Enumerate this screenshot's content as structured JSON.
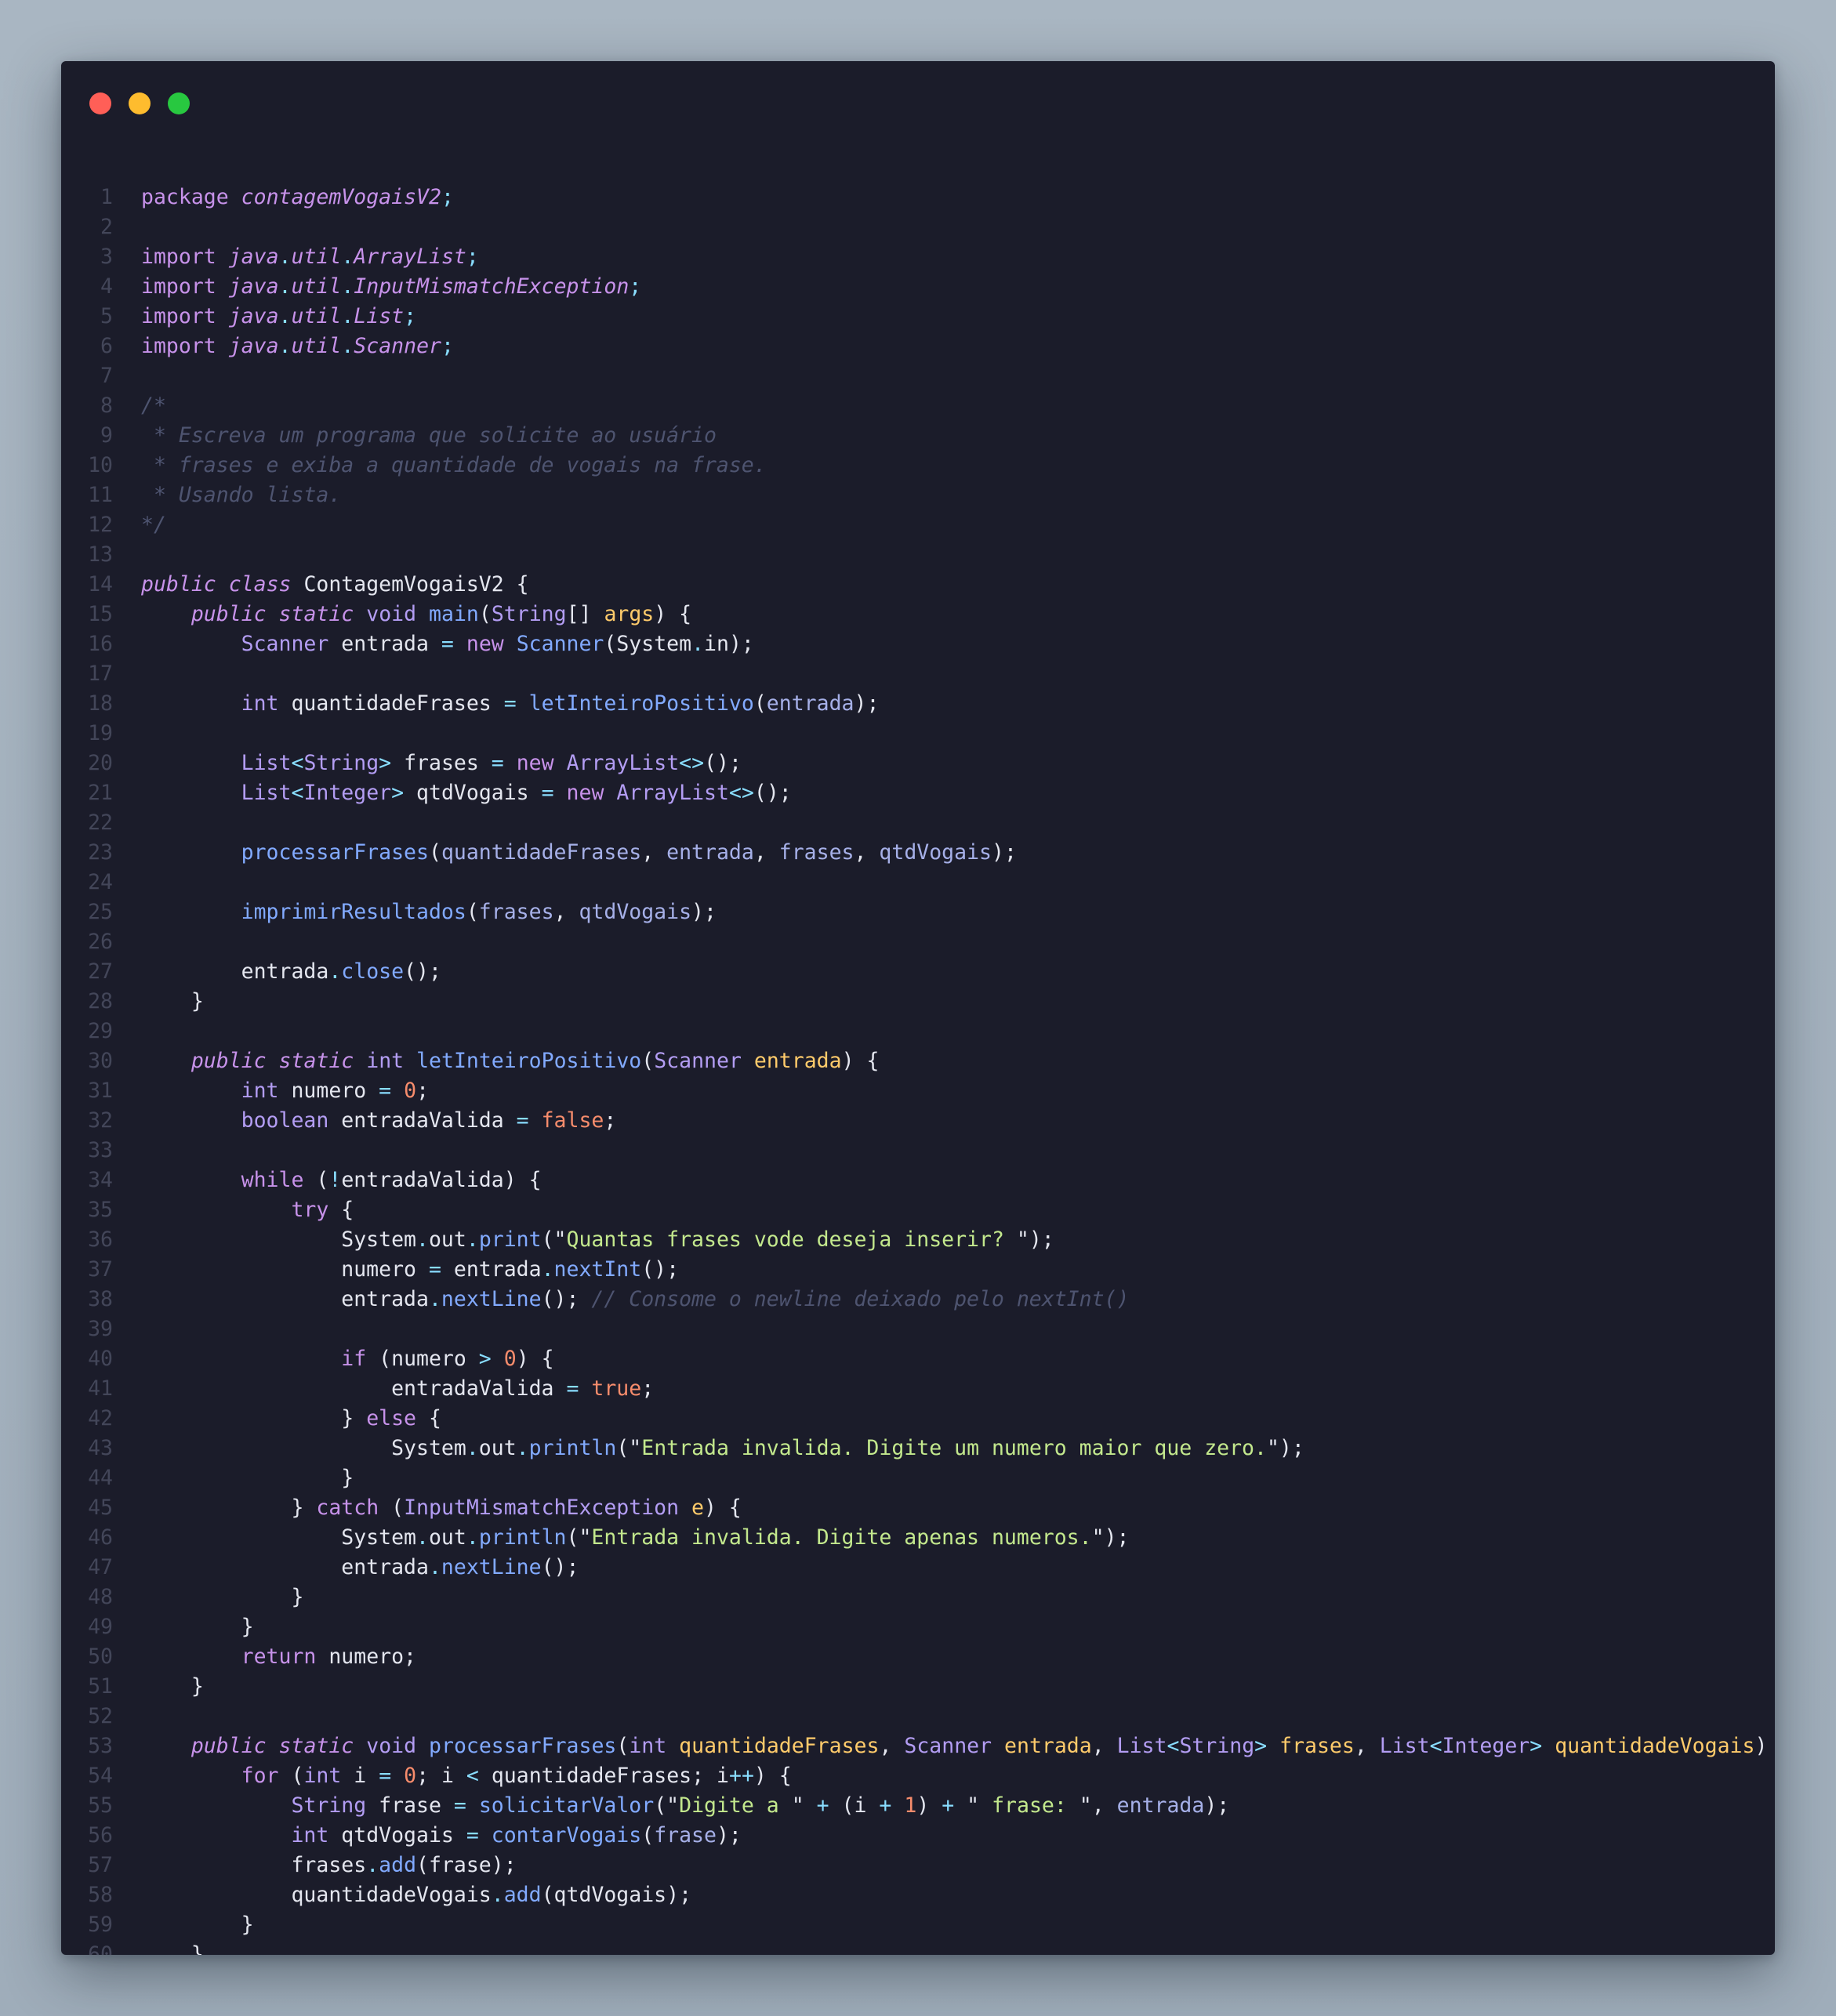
{
  "window": {
    "controls": [
      "close",
      "minimize",
      "maximize"
    ]
  },
  "colors": {
    "background": "#a9b6c2",
    "editor": "#1b1c2a",
    "keyword": "#c792ea",
    "function": "#82aaff",
    "string": "#c3e88d",
    "number": "#f78c6c",
    "param": "#ffcb6b",
    "comment": "#4e5470"
  },
  "code": {
    "language": "java",
    "lines": [
      [
        [
          "kw",
          "package"
        ],
        [
          "txt",
          " "
        ],
        [
          "pkg",
          "contagemVogaisV2"
        ],
        [
          "punc",
          ";"
        ]
      ],
      [],
      [
        [
          "kw",
          "import"
        ],
        [
          "txt",
          " "
        ],
        [
          "pkg",
          "java"
        ],
        [
          "punc",
          "."
        ],
        [
          "pkg",
          "util"
        ],
        [
          "punc",
          "."
        ],
        [
          "pkg",
          "ArrayList"
        ],
        [
          "punc",
          ";"
        ]
      ],
      [
        [
          "kw",
          "import"
        ],
        [
          "txt",
          " "
        ],
        [
          "pkg",
          "java"
        ],
        [
          "punc",
          "."
        ],
        [
          "pkg",
          "util"
        ],
        [
          "punc",
          "."
        ],
        [
          "pkg",
          "InputMismatchException"
        ],
        [
          "punc",
          ";"
        ]
      ],
      [
        [
          "kw",
          "import"
        ],
        [
          "txt",
          " "
        ],
        [
          "pkg",
          "java"
        ],
        [
          "punc",
          "."
        ],
        [
          "pkg",
          "util"
        ],
        [
          "punc",
          "."
        ],
        [
          "pkg",
          "List"
        ],
        [
          "punc",
          ";"
        ]
      ],
      [
        [
          "kw",
          "import"
        ],
        [
          "txt",
          " "
        ],
        [
          "pkg",
          "java"
        ],
        [
          "punc",
          "."
        ],
        [
          "pkg",
          "util"
        ],
        [
          "punc",
          "."
        ],
        [
          "pkg",
          "Scanner"
        ],
        [
          "punc",
          ";"
        ]
      ],
      [],
      [
        [
          "cmt",
          "/*"
        ]
      ],
      [
        [
          "cmt",
          " * Escreva um programa que solicite ao usuário"
        ]
      ],
      [
        [
          "cmt",
          " * frases e exiba a quantidade de vogais na frase."
        ]
      ],
      [
        [
          "cmt",
          " * Usando lista."
        ]
      ],
      [
        [
          "cmt",
          "*/"
        ]
      ],
      [],
      [
        [
          "kwi",
          "public"
        ],
        [
          "txt",
          " "
        ],
        [
          "kwi",
          "class"
        ],
        [
          "txt",
          " ContagemVogaisV2 {"
        ]
      ],
      [
        [
          "txt",
          "    "
        ],
        [
          "kwi",
          "public"
        ],
        [
          "txt",
          " "
        ],
        [
          "kwi",
          "static"
        ],
        [
          "txt",
          " "
        ],
        [
          "typ",
          "void"
        ],
        [
          "txt",
          " "
        ],
        [
          "fn",
          "main"
        ],
        [
          "txt",
          "("
        ],
        [
          "typ",
          "String"
        ],
        [
          "txt",
          "[] "
        ],
        [
          "par",
          "args"
        ],
        [
          "txt",
          ") {"
        ]
      ],
      [
        [
          "txt",
          "        "
        ],
        [
          "typ",
          "Scanner"
        ],
        [
          "txt",
          " entrada "
        ],
        [
          "punc",
          "="
        ],
        [
          "txt",
          " "
        ],
        [
          "kw",
          "new"
        ],
        [
          "txt",
          " "
        ],
        [
          "fn",
          "Scanner"
        ],
        [
          "txt",
          "(System"
        ],
        [
          "punc",
          "."
        ],
        [
          "txt",
          "in);"
        ]
      ],
      [],
      [
        [
          "txt",
          "        "
        ],
        [
          "typ",
          "int"
        ],
        [
          "txt",
          " quantidadeFrases "
        ],
        [
          "punc",
          "="
        ],
        [
          "txt",
          " "
        ],
        [
          "fn",
          "letInteiroPositivo"
        ],
        [
          "txt",
          "("
        ],
        [
          "arg",
          "entrada"
        ],
        [
          "txt",
          ");"
        ]
      ],
      [],
      [
        [
          "txt",
          "        "
        ],
        [
          "typ",
          "List"
        ],
        [
          "punc",
          "<"
        ],
        [
          "typ",
          "String"
        ],
        [
          "punc",
          ">"
        ],
        [
          "txt",
          " frases "
        ],
        [
          "punc",
          "="
        ],
        [
          "txt",
          " "
        ],
        [
          "kw",
          "new"
        ],
        [
          "txt",
          " "
        ],
        [
          "typ",
          "ArrayList"
        ],
        [
          "punc",
          "<>"
        ],
        [
          "txt",
          "();"
        ]
      ],
      [
        [
          "txt",
          "        "
        ],
        [
          "typ",
          "List"
        ],
        [
          "punc",
          "<"
        ],
        [
          "typ",
          "Integer"
        ],
        [
          "punc",
          ">"
        ],
        [
          "txt",
          " qtdVogais "
        ],
        [
          "punc",
          "="
        ],
        [
          "txt",
          " "
        ],
        [
          "kw",
          "new"
        ],
        [
          "txt",
          " "
        ],
        [
          "typ",
          "ArrayList"
        ],
        [
          "punc",
          "<>"
        ],
        [
          "txt",
          "();"
        ]
      ],
      [],
      [
        [
          "txt",
          "        "
        ],
        [
          "fn",
          "processarFrases"
        ],
        [
          "txt",
          "("
        ],
        [
          "arg",
          "quantidadeFrases"
        ],
        [
          "txt",
          ", "
        ],
        [
          "arg",
          "entrada"
        ],
        [
          "txt",
          ", "
        ],
        [
          "arg",
          "frases"
        ],
        [
          "txt",
          ", "
        ],
        [
          "arg",
          "qtdVogais"
        ],
        [
          "txt",
          ");"
        ]
      ],
      [],
      [
        [
          "txt",
          "        "
        ],
        [
          "fn",
          "imprimirResultados"
        ],
        [
          "txt",
          "("
        ],
        [
          "arg",
          "frases"
        ],
        [
          "txt",
          ", "
        ],
        [
          "arg",
          "qtdVogais"
        ],
        [
          "txt",
          ");"
        ]
      ],
      [],
      [
        [
          "txt",
          "        entrada"
        ],
        [
          "punc",
          "."
        ],
        [
          "fn",
          "close"
        ],
        [
          "txt",
          "();"
        ]
      ],
      [
        [
          "txt",
          "    }"
        ]
      ],
      [],
      [
        [
          "txt",
          "    "
        ],
        [
          "kwi",
          "public"
        ],
        [
          "txt",
          " "
        ],
        [
          "kwi",
          "static"
        ],
        [
          "txt",
          " "
        ],
        [
          "typ",
          "int"
        ],
        [
          "txt",
          " "
        ],
        [
          "fn",
          "letInteiroPositivo"
        ],
        [
          "txt",
          "("
        ],
        [
          "typ",
          "Scanner"
        ],
        [
          "txt",
          " "
        ],
        [
          "par",
          "entrada"
        ],
        [
          "txt",
          ") {"
        ]
      ],
      [
        [
          "txt",
          "        "
        ],
        [
          "typ",
          "int"
        ],
        [
          "txt",
          " numero "
        ],
        [
          "punc",
          "="
        ],
        [
          "txt",
          " "
        ],
        [
          "num",
          "0"
        ],
        [
          "txt",
          ";"
        ]
      ],
      [
        [
          "txt",
          "        "
        ],
        [
          "typ",
          "boolean"
        ],
        [
          "txt",
          " entradaValida "
        ],
        [
          "punc",
          "="
        ],
        [
          "txt",
          " "
        ],
        [
          "bool",
          "false"
        ],
        [
          "txt",
          ";"
        ]
      ],
      [],
      [
        [
          "txt",
          "        "
        ],
        [
          "kw",
          "while"
        ],
        [
          "txt",
          " ("
        ],
        [
          "punc",
          "!"
        ],
        [
          "txt",
          "entradaValida) {"
        ]
      ],
      [
        [
          "txt",
          "            "
        ],
        [
          "kw",
          "try"
        ],
        [
          "txt",
          " {"
        ]
      ],
      [
        [
          "txt",
          "                System"
        ],
        [
          "punc",
          "."
        ],
        [
          "txt",
          "out"
        ],
        [
          "punc",
          "."
        ],
        [
          "fn",
          "print"
        ],
        [
          "txt",
          "(\""
        ],
        [
          "str",
          "Quantas frases vode deseja inserir? "
        ],
        [
          "txt",
          "\");"
        ]
      ],
      [
        [
          "txt",
          "                numero "
        ],
        [
          "punc",
          "="
        ],
        [
          "txt",
          " entrada"
        ],
        [
          "punc",
          "."
        ],
        [
          "fn",
          "nextInt"
        ],
        [
          "txt",
          "();"
        ]
      ],
      [
        [
          "txt",
          "                entrada"
        ],
        [
          "punc",
          "."
        ],
        [
          "fn",
          "nextLine"
        ],
        [
          "txt",
          "(); "
        ],
        [
          "cmt",
          "// Consome o newline deixado pelo nextInt()"
        ]
      ],
      [],
      [
        [
          "txt",
          "                "
        ],
        [
          "kw",
          "if"
        ],
        [
          "txt",
          " (numero "
        ],
        [
          "punc",
          ">"
        ],
        [
          "txt",
          " "
        ],
        [
          "num",
          "0"
        ],
        [
          "txt",
          ") {"
        ]
      ],
      [
        [
          "txt",
          "                    entradaValida "
        ],
        [
          "punc",
          "="
        ],
        [
          "txt",
          " "
        ],
        [
          "bool",
          "true"
        ],
        [
          "txt",
          ";"
        ]
      ],
      [
        [
          "txt",
          "                } "
        ],
        [
          "kw",
          "else"
        ],
        [
          "txt",
          " {"
        ]
      ],
      [
        [
          "txt",
          "                    System"
        ],
        [
          "punc",
          "."
        ],
        [
          "txt",
          "out"
        ],
        [
          "punc",
          "."
        ],
        [
          "fn",
          "println"
        ],
        [
          "txt",
          "(\""
        ],
        [
          "str",
          "Entrada invalida. Digite um numero maior que zero."
        ],
        [
          "txt",
          "\");"
        ]
      ],
      [
        [
          "txt",
          "                }"
        ]
      ],
      [
        [
          "txt",
          "            } "
        ],
        [
          "kw",
          "catch"
        ],
        [
          "txt",
          " ("
        ],
        [
          "typ",
          "InputMismatchException"
        ],
        [
          "txt",
          " "
        ],
        [
          "par",
          "e"
        ],
        [
          "txt",
          ") {"
        ]
      ],
      [
        [
          "txt",
          "                System"
        ],
        [
          "punc",
          "."
        ],
        [
          "txt",
          "out"
        ],
        [
          "punc",
          "."
        ],
        [
          "fn",
          "println"
        ],
        [
          "txt",
          "(\""
        ],
        [
          "str",
          "Entrada invalida. Digite apenas numeros."
        ],
        [
          "txt",
          "\");"
        ]
      ],
      [
        [
          "txt",
          "                entrada"
        ],
        [
          "punc",
          "."
        ],
        [
          "fn",
          "nextLine"
        ],
        [
          "txt",
          "();"
        ]
      ],
      [
        [
          "txt",
          "            }"
        ]
      ],
      [
        [
          "txt",
          "        }"
        ]
      ],
      [
        [
          "txt",
          "        "
        ],
        [
          "kw",
          "return"
        ],
        [
          "txt",
          " numero;"
        ]
      ],
      [
        [
          "txt",
          "    }"
        ]
      ],
      [],
      [
        [
          "txt",
          "    "
        ],
        [
          "kwi",
          "public"
        ],
        [
          "txt",
          " "
        ],
        [
          "kwi",
          "static"
        ],
        [
          "txt",
          " "
        ],
        [
          "typ",
          "void"
        ],
        [
          "txt",
          " "
        ],
        [
          "fn",
          "processarFrases"
        ],
        [
          "txt",
          "("
        ],
        [
          "typ",
          "int"
        ],
        [
          "txt",
          " "
        ],
        [
          "par",
          "quantidadeFrases"
        ],
        [
          "txt",
          ", "
        ],
        [
          "typ",
          "Scanner"
        ],
        [
          "txt",
          " "
        ],
        [
          "par",
          "entrada"
        ],
        [
          "txt",
          ", "
        ],
        [
          "typ",
          "List"
        ],
        [
          "punc",
          "<"
        ],
        [
          "typ",
          "String"
        ],
        [
          "punc",
          ">"
        ],
        [
          "txt",
          " "
        ],
        [
          "par",
          "frases"
        ],
        [
          "txt",
          ", "
        ],
        [
          "typ",
          "List"
        ],
        [
          "punc",
          "<"
        ],
        [
          "typ",
          "Integer"
        ],
        [
          "punc",
          ">"
        ],
        [
          "txt",
          " "
        ],
        [
          "par",
          "quantidadeVogais"
        ],
        [
          "txt",
          ") {"
        ]
      ],
      [
        [
          "txt",
          "        "
        ],
        [
          "kw",
          "for"
        ],
        [
          "txt",
          " ("
        ],
        [
          "typ",
          "int"
        ],
        [
          "txt",
          " i "
        ],
        [
          "punc",
          "="
        ],
        [
          "txt",
          " "
        ],
        [
          "num",
          "0"
        ],
        [
          "txt",
          "; i "
        ],
        [
          "punc",
          "<"
        ],
        [
          "txt",
          " quantidadeFrases; i"
        ],
        [
          "punc",
          "++"
        ],
        [
          "txt",
          ") {"
        ]
      ],
      [
        [
          "txt",
          "            "
        ],
        [
          "typ",
          "String"
        ],
        [
          "txt",
          " frase "
        ],
        [
          "punc",
          "="
        ],
        [
          "txt",
          " "
        ],
        [
          "fn",
          "solicitarValor"
        ],
        [
          "txt",
          "(\""
        ],
        [
          "str",
          "Digite a "
        ],
        [
          "txt",
          "\" "
        ],
        [
          "punc",
          "+"
        ],
        [
          "txt",
          " (i "
        ],
        [
          "punc",
          "+"
        ],
        [
          "txt",
          " "
        ],
        [
          "num",
          "1"
        ],
        [
          "txt",
          ") "
        ],
        [
          "punc",
          "+"
        ],
        [
          "txt",
          " \""
        ],
        [
          "str",
          " frase: "
        ],
        [
          "txt",
          "\", "
        ],
        [
          "arg",
          "entrada"
        ],
        [
          "txt",
          ");"
        ]
      ],
      [
        [
          "txt",
          "            "
        ],
        [
          "typ",
          "int"
        ],
        [
          "txt",
          " qtdVogais "
        ],
        [
          "punc",
          "="
        ],
        [
          "txt",
          " "
        ],
        [
          "fn",
          "contarVogais"
        ],
        [
          "txt",
          "("
        ],
        [
          "arg",
          "frase"
        ],
        [
          "txt",
          ");"
        ]
      ],
      [
        [
          "txt",
          "            frases"
        ],
        [
          "punc",
          "."
        ],
        [
          "fn",
          "add"
        ],
        [
          "txt",
          "(frase);"
        ]
      ],
      [
        [
          "txt",
          "            quantidadeVogais"
        ],
        [
          "punc",
          "."
        ],
        [
          "fn",
          "add"
        ],
        [
          "txt",
          "(qtdVogais);"
        ]
      ],
      [
        [
          "txt",
          "        }"
        ]
      ],
      [
        [
          "txt",
          "    }"
        ]
      ]
    ]
  }
}
